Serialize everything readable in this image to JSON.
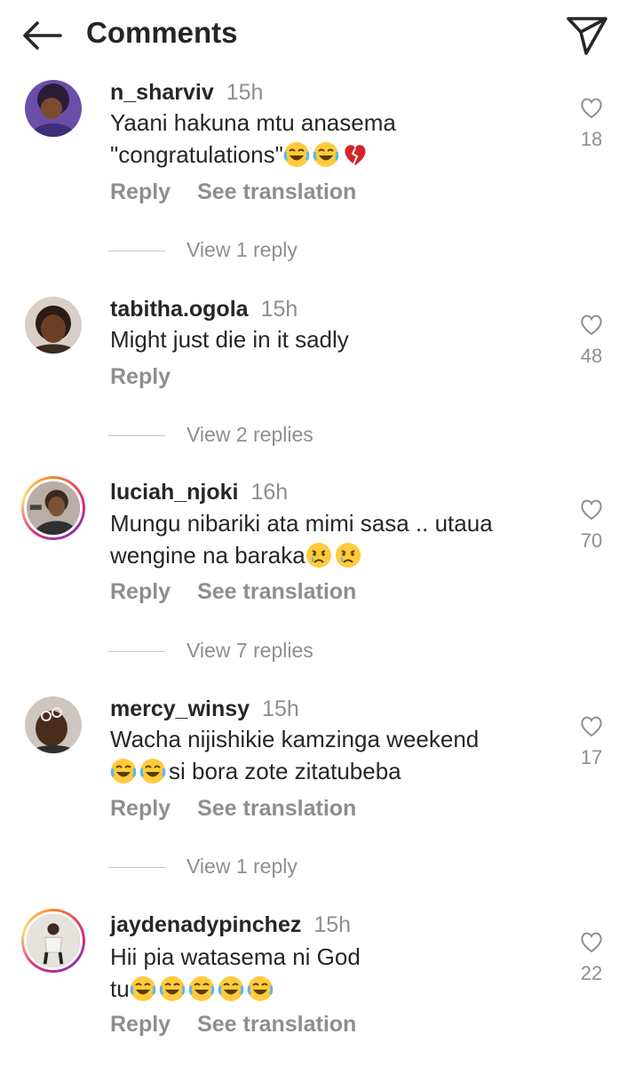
{
  "header": {
    "title": "Comments",
    "back_icon": "arrow-left-icon",
    "share_icon": "paper-plane-icon"
  },
  "comments": [
    {
      "username": "n_sharviv",
      "time": "15h",
      "text": "Yaani hakuna mtu anasema \"congratulations\"",
      "emojis": [
        "laughing-crying",
        "laughing-crying",
        "broken-heart"
      ],
      "likes": "18",
      "reply_label": "Reply",
      "translation_label": "See translation",
      "view_replies": "View 1 reply"
    },
    {
      "username": "tabitha.ogola",
      "time": "15h",
      "text": "Might just die in it sadly",
      "emojis": [],
      "likes": "48",
      "reply_label": "Reply",
      "view_replies": "View 2 replies"
    },
    {
      "username": "luciah_njoki",
      "time": "16h",
      "text": "Mungu nibariki ata mimi sasa .. utaua wengine na baraka",
      "emojis": [
        "crying",
        "crying"
      ],
      "likes": "70",
      "reply_label": "Reply",
      "translation_label": "See translation",
      "view_replies": "View 7 replies"
    },
    {
      "username": "mercy_winsy",
      "time": "15h",
      "text_line1": "Wacha nijishikie kamzinga weekend",
      "text_line2": "si bora zote zitatubeba",
      "emojis": [
        "laughing-crying",
        "laughing-crying"
      ],
      "likes": "17",
      "reply_label": "Reply",
      "translation_label": "See translation",
      "view_replies": "View 1 reply"
    },
    {
      "username": "jaydenadypinchez",
      "time": "15h",
      "text_line1": "Hii pia watasema ni God",
      "text_line2": "tu",
      "emojis": [
        "laughing-crying",
        "laughing-crying",
        "laughing-crying",
        "laughing-crying",
        "laughing-crying"
      ],
      "likes": "22",
      "reply_label": "Reply",
      "translation_label": "See translation"
    }
  ],
  "colors": {
    "text": "#262626",
    "secondary": "#8e8e8e",
    "divider": "#c7c7c7",
    "story_ring": "#dd2a7b",
    "emoji_yellow": "#ffcb3d",
    "tear_blue": "#5bb5f5",
    "heart_red": "#d8232a"
  }
}
